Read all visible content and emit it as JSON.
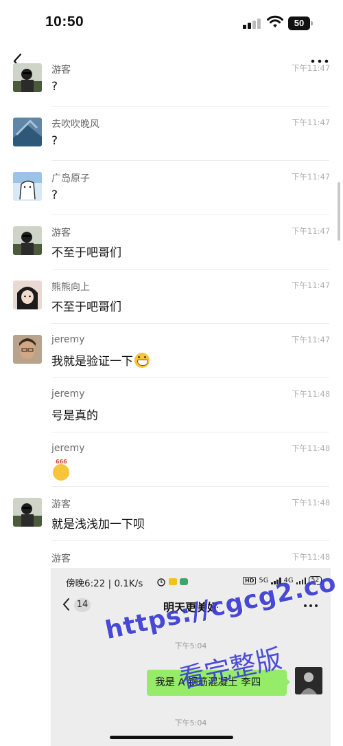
{
  "status_bar": {
    "time": "10:50",
    "battery": "50"
  },
  "messages": [
    {
      "sender": "游客",
      "time": "下午11:47",
      "text": "?",
      "emoji": ""
    },
    {
      "sender": "去吹吹晚风",
      "time": "下午11:47",
      "text": "?",
      "emoji": ""
    },
    {
      "sender": "广岛原子",
      "time": "下午11:47",
      "text": "?",
      "emoji": ""
    },
    {
      "sender": "游客",
      "time": "下午11:47",
      "text": "不至于吧哥们",
      "emoji": ""
    },
    {
      "sender": "熊熊向上",
      "time": "下午11:47",
      "text": "不至于吧哥们",
      "emoji": ""
    },
    {
      "sender": "jeremy",
      "time": "下午11:47",
      "text": "我就是验证一下",
      "emoji": "grin-emoji"
    },
    {
      "sender": "jeremy",
      "time": "下午11:48",
      "text": "号是真的",
      "emoji": ""
    },
    {
      "sender": "jeremy",
      "time": "下午11:48",
      "text": "",
      "emoji": "666-emoji"
    },
    {
      "sender": "游客",
      "time": "下午11:48",
      "text": "就是浅浅加一下呗",
      "emoji": ""
    },
    {
      "sender": "游客",
      "time": "下午11:48",
      "text": "",
      "emoji": ""
    }
  ],
  "embedded_screenshot": {
    "status_time": "傍晚6:22 | 0.1K/s",
    "hd_label": "HD",
    "net1": "5G",
    "net2": "4G",
    "battery": "52",
    "unread_count": "14",
    "chat_title": "明天更美好",
    "timestamp_1": "下午5:04",
    "bubble_text": "我是 A 钢筋混凝土 李四",
    "timestamp_2": "下午5:04"
  },
  "watermark": {
    "url": "https://cgcg2.co",
    "text": "看完整版"
  },
  "colors": {
    "bubble_green": "#95ec69",
    "watermark_blue": "#3b3bd6",
    "time_gray": "#b0b0b0"
  }
}
